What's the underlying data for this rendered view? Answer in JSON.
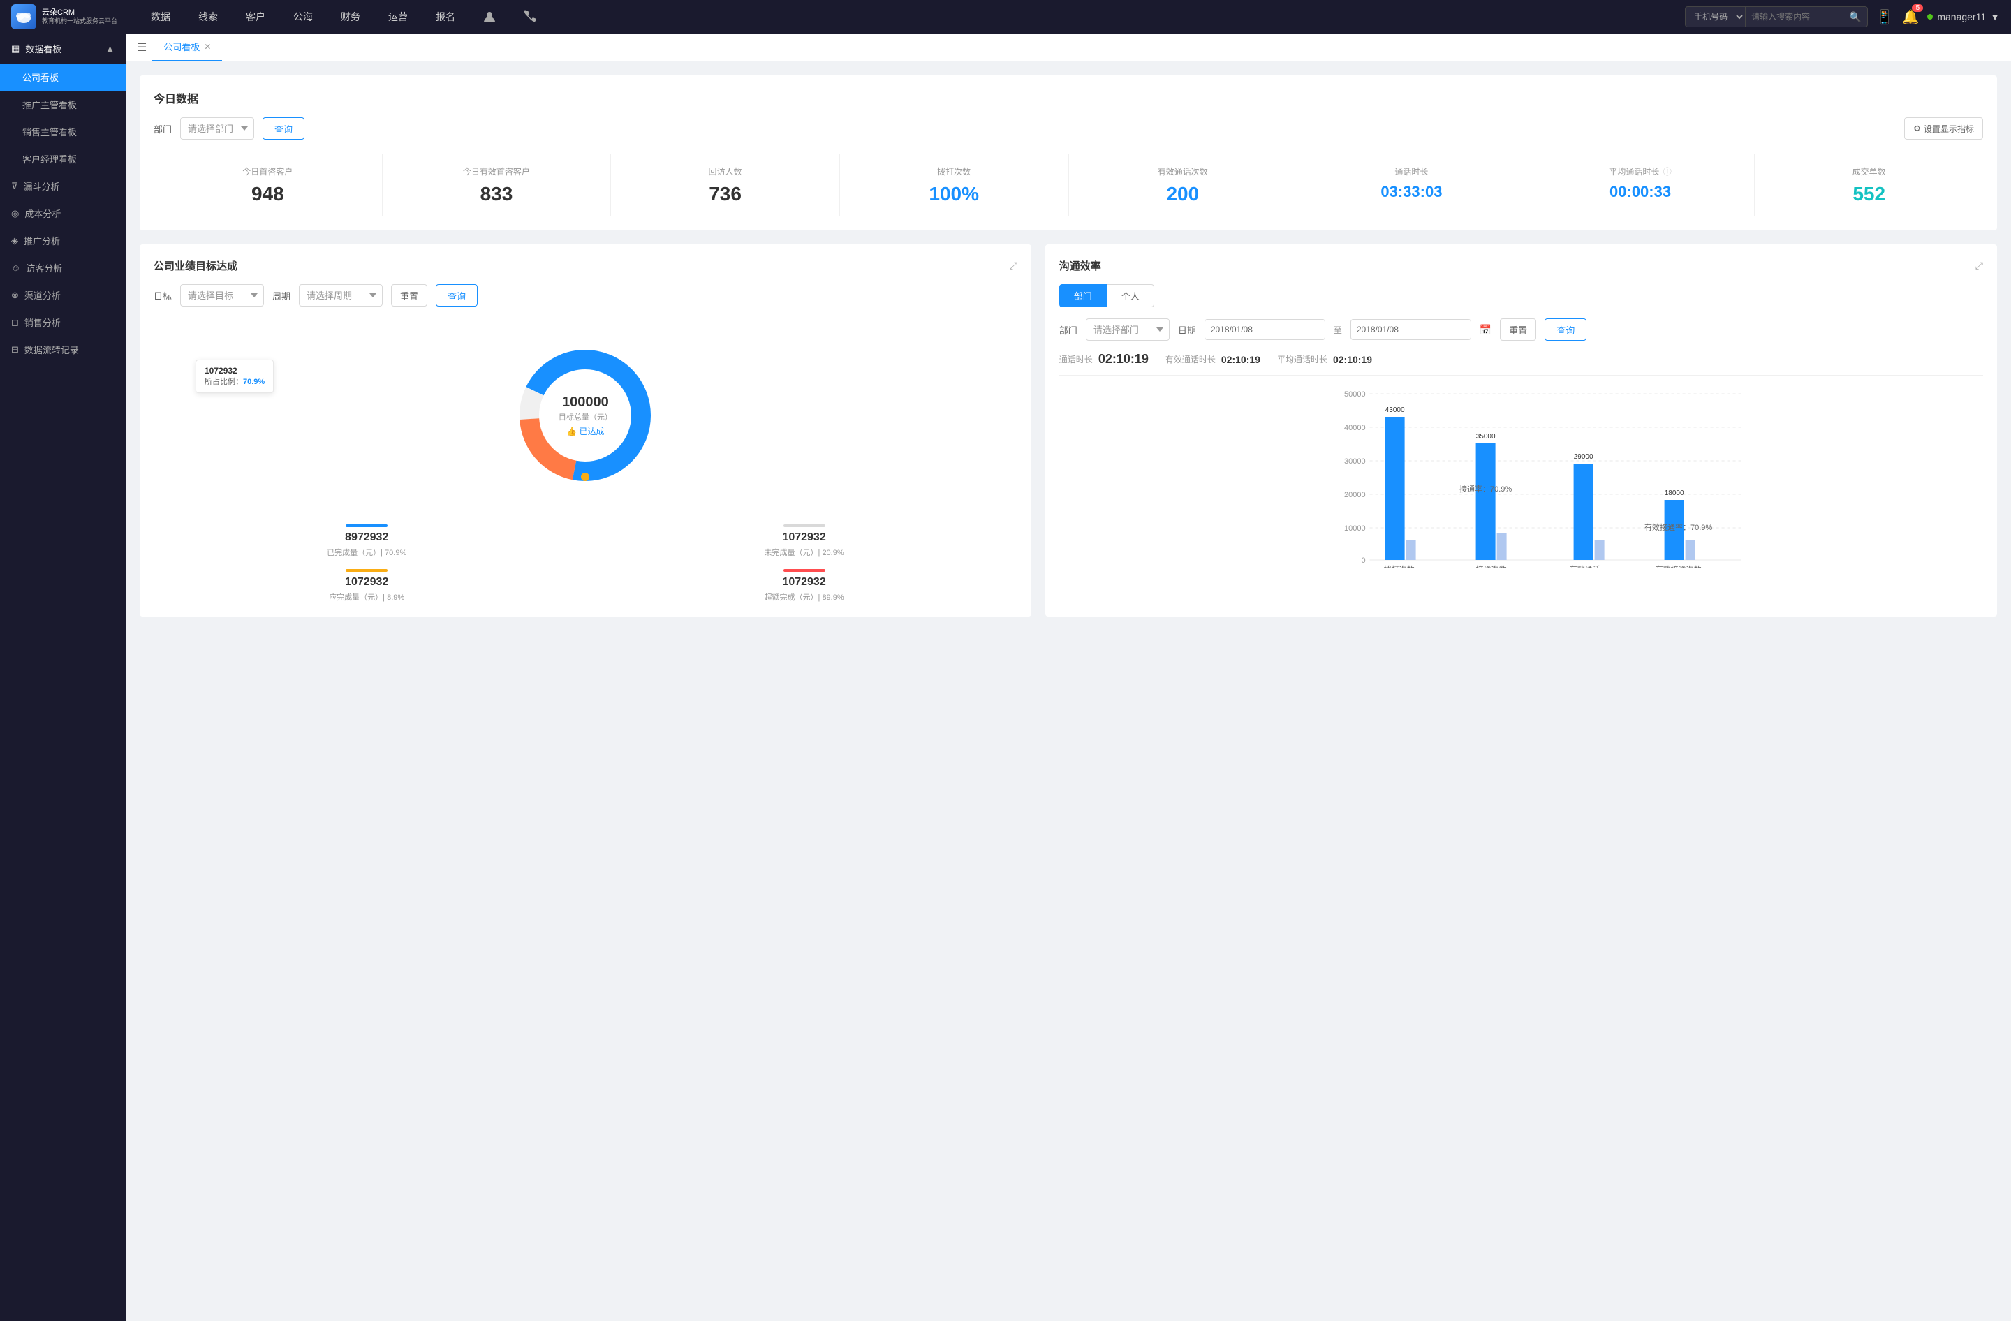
{
  "app": {
    "name": "云朵CRM",
    "subtitle": "教育机构一站式服务云平台"
  },
  "topNav": {
    "items": [
      "数据",
      "线索",
      "客户",
      "公海",
      "财务",
      "运营",
      "报名"
    ],
    "search": {
      "placeholder": "请输入搜索内容",
      "filterLabel": "手机号码"
    },
    "notifications": "5",
    "user": "manager11"
  },
  "sidebar": {
    "sections": [
      {
        "label": "数据看板",
        "items": [
          {
            "label": "公司看板",
            "active": true
          },
          {
            "label": "推广主管看板",
            "active": false
          },
          {
            "label": "销售主管看板",
            "active": false
          },
          {
            "label": "客户经理看板",
            "active": false
          }
        ]
      },
      {
        "label": "漏斗分析",
        "items": []
      },
      {
        "label": "成本分析",
        "items": []
      },
      {
        "label": "推广分析",
        "items": []
      },
      {
        "label": "访客分析",
        "items": []
      },
      {
        "label": "渠道分析",
        "items": []
      },
      {
        "label": "销售分析",
        "items": []
      },
      {
        "label": "数据流转记录",
        "items": []
      }
    ]
  },
  "tab": {
    "label": "公司看板"
  },
  "todayData": {
    "title": "今日数据",
    "filterLabel": "部门",
    "filterPlaceholder": "请选择部门",
    "queryBtn": "查询",
    "settingsBtn": "设置显示指标",
    "stats": [
      {
        "label": "今日首咨客户",
        "value": "948",
        "color": "black"
      },
      {
        "label": "今日有效首咨客户",
        "value": "833",
        "color": "black"
      },
      {
        "label": "回访人数",
        "value": "736",
        "color": "black"
      },
      {
        "label": "拨打次数",
        "value": "100%",
        "color": "blue"
      },
      {
        "label": "有效通话次数",
        "value": "200",
        "color": "blue"
      },
      {
        "label": "通话时长",
        "value": "03:33:03",
        "color": "blue"
      },
      {
        "label": "平均通话时长",
        "value": "00:00:33",
        "color": "blue"
      },
      {
        "label": "成交单数",
        "value": "552",
        "color": "cyan"
      }
    ]
  },
  "goalChart": {
    "title": "公司业绩目标达成",
    "targetLabel": "目标",
    "targetPlaceholder": "请选择目标",
    "periodLabel": "周期",
    "periodPlaceholder": "请选择周期",
    "resetBtn": "重置",
    "queryBtn": "查询",
    "centerValue": "100000",
    "centerLabel": "目标总量（元）",
    "centerAchieved": "👍 已达成",
    "tooltip": {
      "value": "1072932",
      "percentLabel": "所占比例：",
      "percent": "70.9%"
    },
    "stats": [
      {
        "label": "已完成量（元）| 70.9%",
        "value": "8972932",
        "barColor": "#1890ff"
      },
      {
        "label": "未完成量（元）| 20.9%",
        "value": "1072932",
        "barColor": "#d9d9d9"
      },
      {
        "label": "应完成量（元）| 8.9%",
        "value": "1072932",
        "barColor": "#faad14"
      },
      {
        "label": "超额完成（元）| 89.9%",
        "value": "1072932",
        "barColor": "#ff4d4f"
      }
    ],
    "donut": {
      "completed": 70.9,
      "remaining": 20.9,
      "extra": 8.2
    }
  },
  "commChart": {
    "title": "沟通效率",
    "tabs": [
      "部门",
      "个人"
    ],
    "activeTab": "部门",
    "filterLabel": "部门",
    "filterPlaceholder": "请选择部门",
    "dateLabel": "日期",
    "dateFrom": "2018/01/08",
    "dateTo": "2018/01/08",
    "resetBtn": "重置",
    "queryBtn": "查询",
    "times": [
      {
        "label": "通话时长",
        "value": "02:10:19"
      },
      {
        "label": "有效通话时长",
        "value": "02:10:19"
      },
      {
        "label": "平均通话时长",
        "value": "02:10:19"
      }
    ],
    "yAxis": [
      "50000",
      "40000",
      "30000",
      "20000",
      "10000",
      "0"
    ],
    "bars": [
      {
        "groupLabel": "拨打次数",
        "bars": [
          {
            "value": 43000,
            "label": "43000",
            "color": "#1890ff",
            "height": 86
          },
          {
            "value": 5000,
            "label": "",
            "color": "#b0c8f0",
            "height": 10
          }
        ]
      },
      {
        "groupLabel": "接通次数",
        "centerLabel": "接通率：70.9%",
        "bars": [
          {
            "value": 35000,
            "label": "35000",
            "color": "#1890ff",
            "height": 70
          },
          {
            "value": 8000,
            "label": "",
            "color": "#b0c8f0",
            "height": 16
          }
        ]
      },
      {
        "groupLabel": "有效通话",
        "bars": [
          {
            "value": 29000,
            "label": "29000",
            "color": "#1890ff",
            "height": 58
          },
          {
            "value": 6000,
            "label": "",
            "color": "#b0c8f0",
            "height": 12
          }
        ]
      },
      {
        "groupLabel": "有效接通次数",
        "centerLabel": "有效接通率：70.9%",
        "bars": [
          {
            "value": 18000,
            "label": "18000",
            "color": "#1890ff",
            "height": 36
          },
          {
            "value": 6000,
            "label": "",
            "color": "#b0c8f0",
            "height": 12
          }
        ]
      }
    ]
  }
}
